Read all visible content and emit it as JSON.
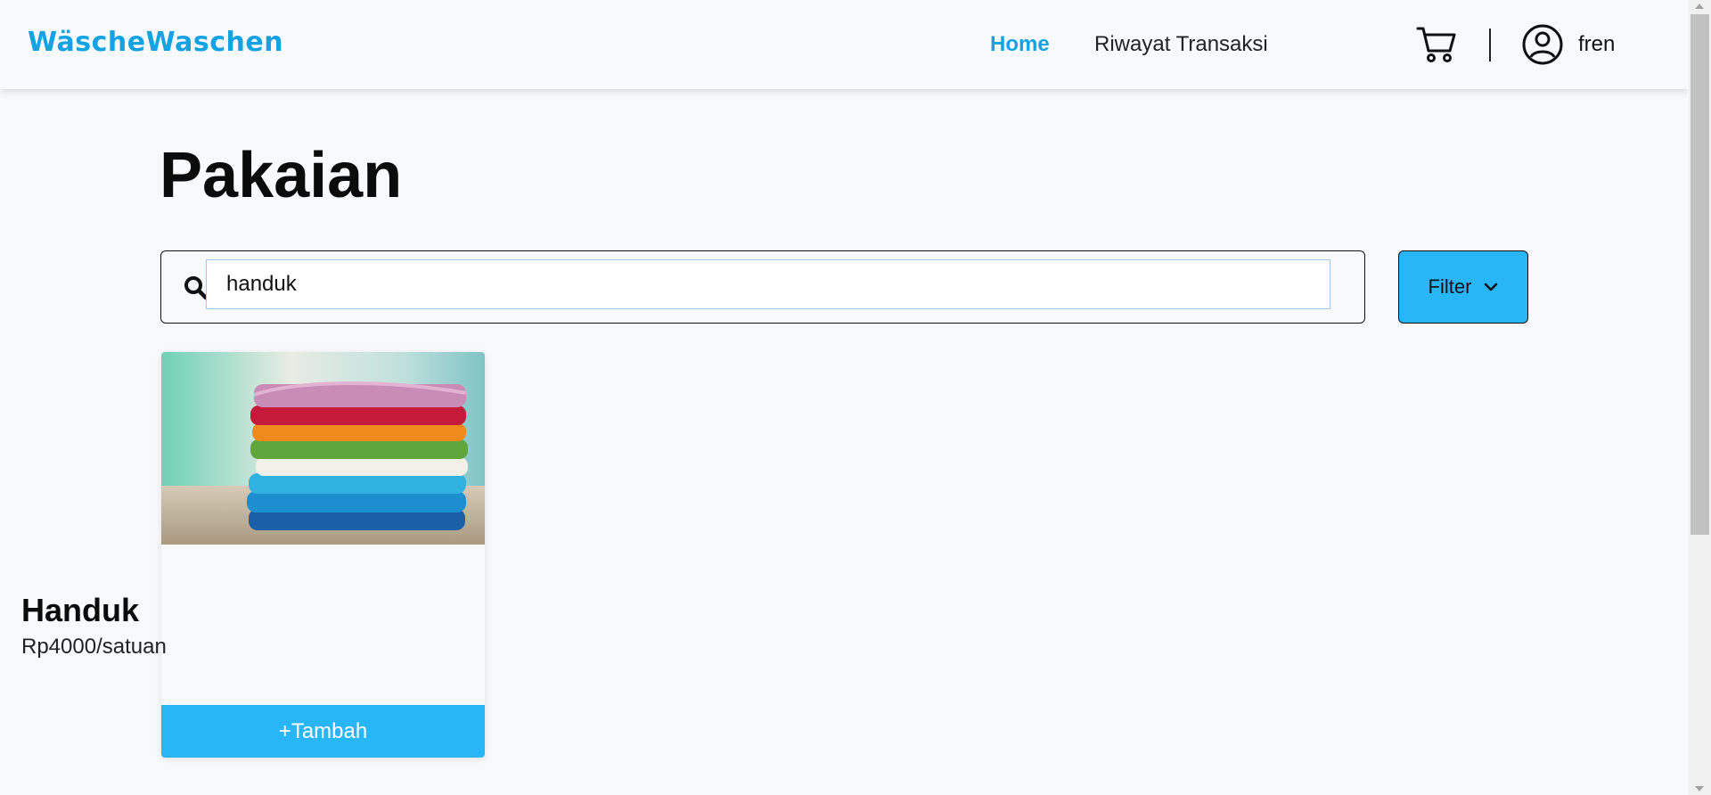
{
  "brand": "WäscheWaschen",
  "nav": {
    "home_label": "Home",
    "history_label": "Riwayat Transaksi",
    "username": "fren",
    "cart_icon": "cart-icon",
    "user_icon": "user-circle-icon"
  },
  "page_title": "Pakaian",
  "search": {
    "value": "handuk",
    "icon": "search-icon"
  },
  "filter": {
    "label": "Filter",
    "icon": "chevron-down-icon"
  },
  "products": [
    {
      "name": "Handuk",
      "price": "Rp4000/satuan",
      "add_label": "+Tambah",
      "image": "stacked-towels-image"
    }
  ],
  "colors": {
    "accent": "#13a2e2",
    "button": "#29b6f6",
    "background": "#f8f9fb"
  }
}
